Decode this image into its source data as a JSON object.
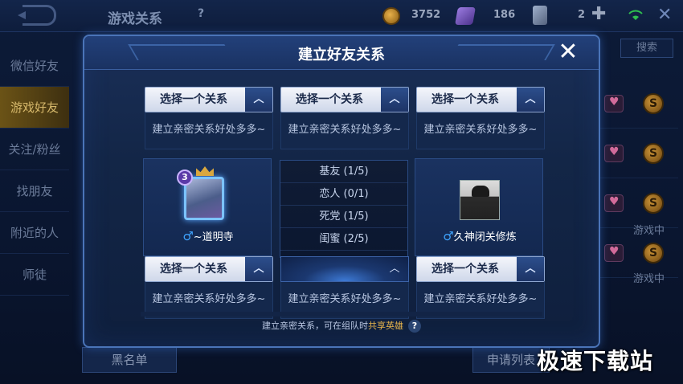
{
  "topbar": {
    "title": "游戏关系",
    "help": "?",
    "coins": "3752",
    "gems": "186",
    "cards": "2"
  },
  "left_nav": [
    "微信好友",
    "游戏好友",
    "关注/粉丝",
    "找朋友",
    "附近的人",
    "师徒"
  ],
  "right_panel": {
    "search": "搜索",
    "status": [
      "游戏中",
      "游戏中"
    ]
  },
  "footer_buttons": {
    "blacklist": "黑名单",
    "apply_list": "申请列表"
  },
  "watermark": "极速下载站",
  "modal": {
    "title": "建立好友关系",
    "close": "✕",
    "select_label": "选择一个关系",
    "benefit_text": "建立亲密关系好处多多~",
    "players": [
      {
        "name": "~道明寺",
        "gender": "♂",
        "level_badge": "3"
      },
      {
        "name": "久神闭关修炼",
        "gender": "♂"
      }
    ],
    "dropdown_options": [
      "基友 (1/5)",
      "恋人 (0/1)",
      "死党 (1/5)",
      "闺蜜 (2/5)"
    ],
    "footer_note": "建立亲密关系，可在组队时",
    "footer_highlight": "共享英雄",
    "footer_help": "?"
  }
}
